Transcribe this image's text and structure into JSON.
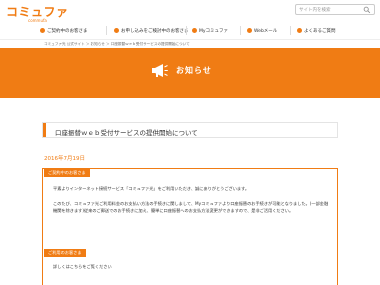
{
  "header": {
    "logo_text": "コミュファ",
    "logo_sub": "commufa",
    "search_placeholder": "サイト内を検索"
  },
  "nav": {
    "items": [
      {
        "label": "ご契約中のお客さま"
      },
      {
        "label": "お申し込みをご検討中のお客さま"
      },
      {
        "label": "Myコミュファ"
      },
      {
        "label": "Webメール"
      },
      {
        "label": "よくあるご質問"
      }
    ]
  },
  "breadcrumb": "コミュファ光 公式サイト ＞ お知らせ ＞ 口座振替ｗｅｂ受付サービスの提供開始について",
  "hero": {
    "title": "お知らせ"
  },
  "article": {
    "title": "口座振替ｗｅｂ受付サービスの提供開始について",
    "date": "2016年7月19日",
    "tag1": "ご契約中のお客さま",
    "para1": "平素よりインターネット接続サービス「コミュファ光」をご利用いただき、誠にありがとうございます。",
    "para2": "このたび、コミュファ光ご利用料金のお支払い方法の手続きに関しまして、Myコミュファより口座振替のお手続きが可能となりました。(一部金融機関を除きます)従来のご郵送でのお手続きに加え、簡単に口座振替へのお支払方法変更ができますので、是非ご活用ください。",
    "tag2": "ご利用のお客さま",
    "para3": "詳しくはこちらをご覧ください"
  },
  "colors": {
    "accent": "#f07c14"
  }
}
